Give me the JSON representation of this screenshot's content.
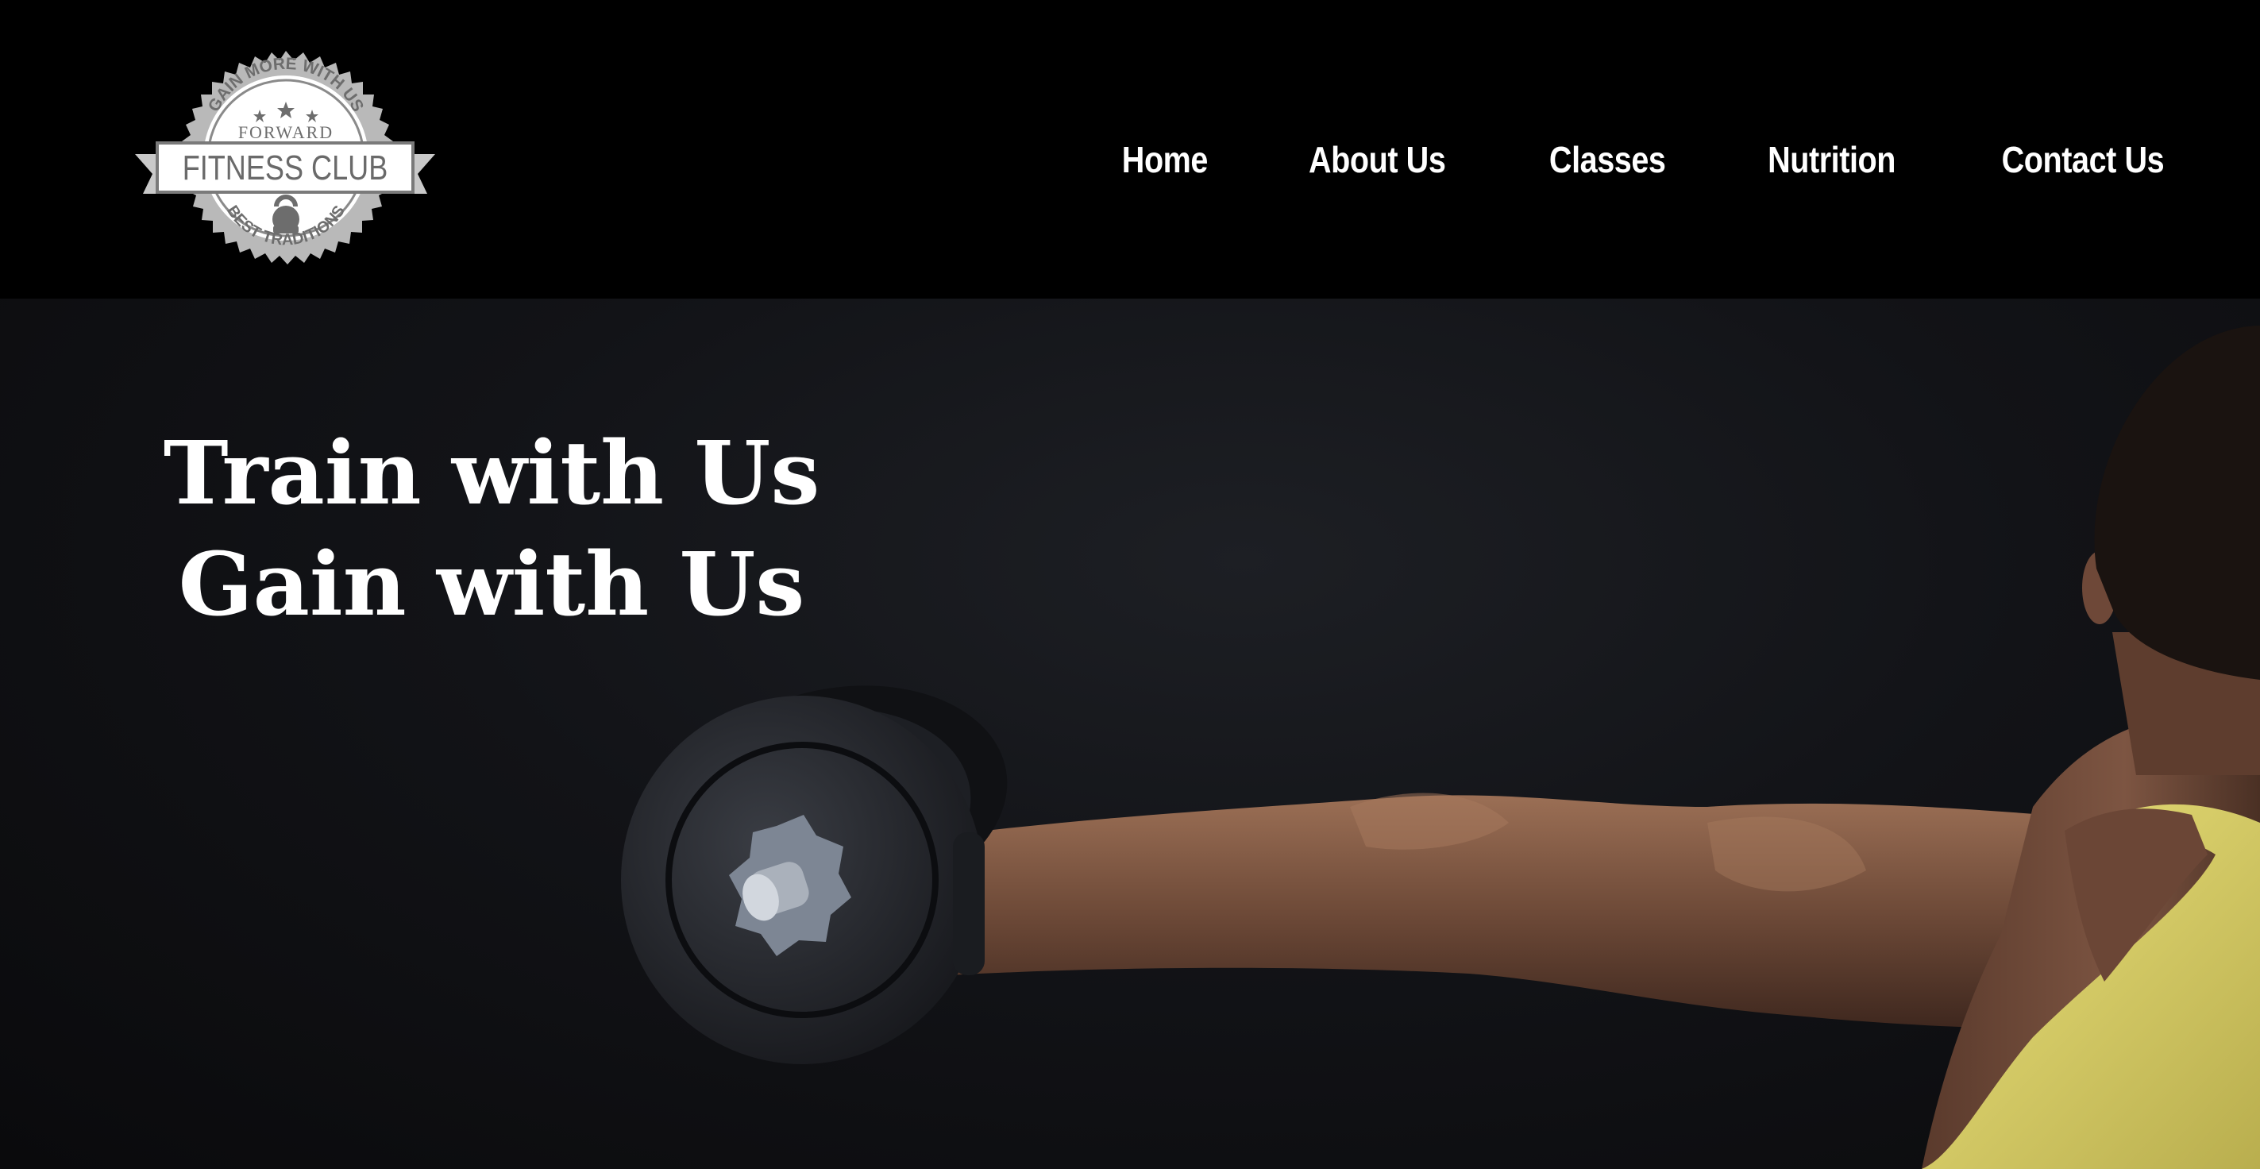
{
  "logo": {
    "top_arc": "GAIN MORE WITH US",
    "subtitle": "FORWARD",
    "banner": "FITNESS CLUB",
    "bottom_arc": "BEST TRADITIONS"
  },
  "nav": {
    "items": [
      {
        "label": "Home"
      },
      {
        "label": "About Us"
      },
      {
        "label": "Classes"
      },
      {
        "label": "Nutrition"
      },
      {
        "label": "Contact Us"
      }
    ]
  },
  "hero": {
    "line1": "Train with Us",
    "line2": "Gain with Us"
  },
  "colors": {
    "header_bg": "#000000",
    "hero_bg": "#121317",
    "text": "#ffffff",
    "skin": "#7a5440",
    "tank_top": "#d8cf6a"
  },
  "icons": {
    "logo_badge": "fitness-club-badge-icon",
    "kettlebell": "kettlebell-icon"
  }
}
